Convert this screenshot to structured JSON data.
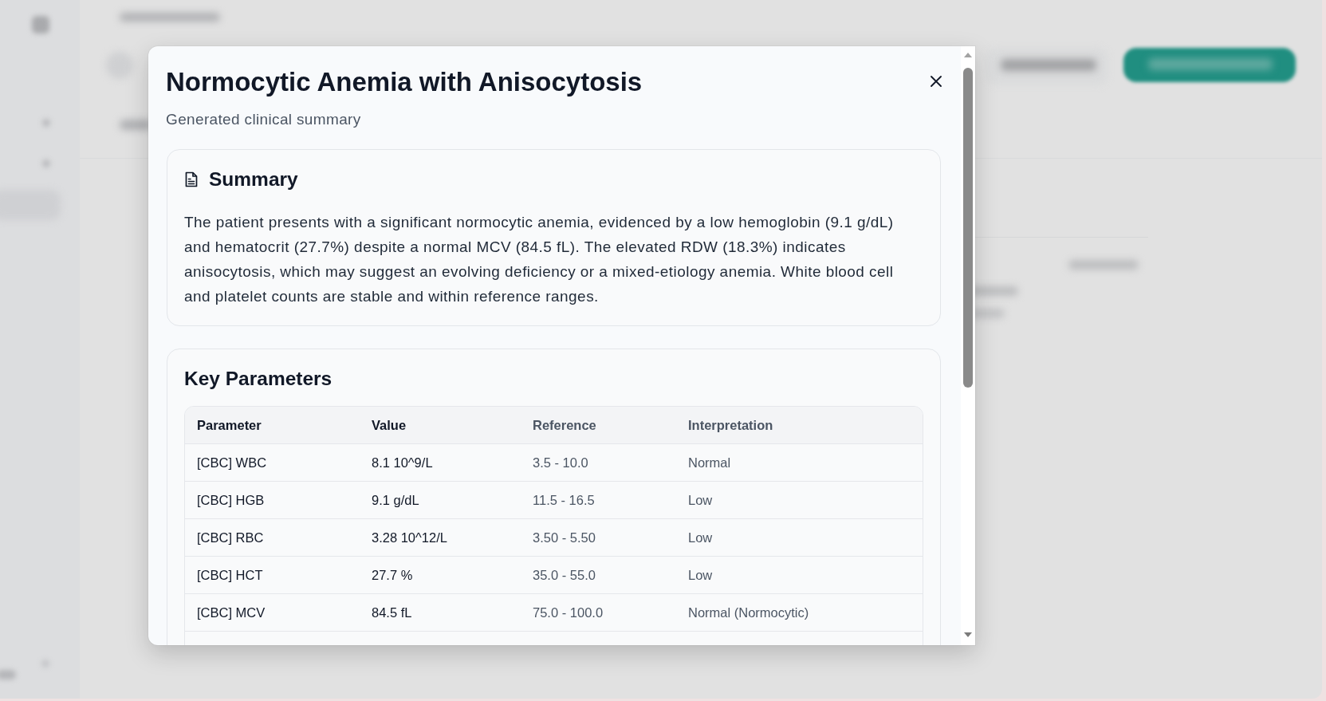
{
  "dialog": {
    "title": "Normocytic Anemia with Anisocytosis",
    "subtitle": "Generated clinical summary",
    "summary": {
      "heading": "Summary",
      "text": "The patient presents with a significant normocytic anemia, evidenced by a low hemoglobin (9.1 g/dL) and hematocrit (27.7%) despite a normal MCV (84.5 fL). The elevated RDW (18.3%) indicates anisocytosis, which may suggest an evolving deficiency or a mixed-etiology anemia. White blood cell and platelet counts are stable and within reference ranges."
    },
    "key_parameters": {
      "heading": "Key Parameters",
      "table": {
        "columns": [
          "Parameter",
          "Value",
          "Reference",
          "Interpretation"
        ],
        "rows": [
          [
            "[CBC] WBC",
            "8.1 10^9/L",
            "3.5 - 10.0",
            "Normal"
          ],
          [
            "[CBC] HGB",
            "9.1 g/dL",
            "11.5 - 16.5",
            "Low"
          ],
          [
            "[CBC] RBC",
            "3.28 10^12/L",
            "3.50 - 5.50",
            "Low"
          ],
          [
            "[CBC] HCT",
            "27.7 %",
            "35.0 - 55.0",
            "Low"
          ],
          [
            "[CBC] MCV",
            "84.5 fL",
            "75.0 - 100.0",
            "Normal (Normocytic)"
          ]
        ]
      }
    }
  }
}
